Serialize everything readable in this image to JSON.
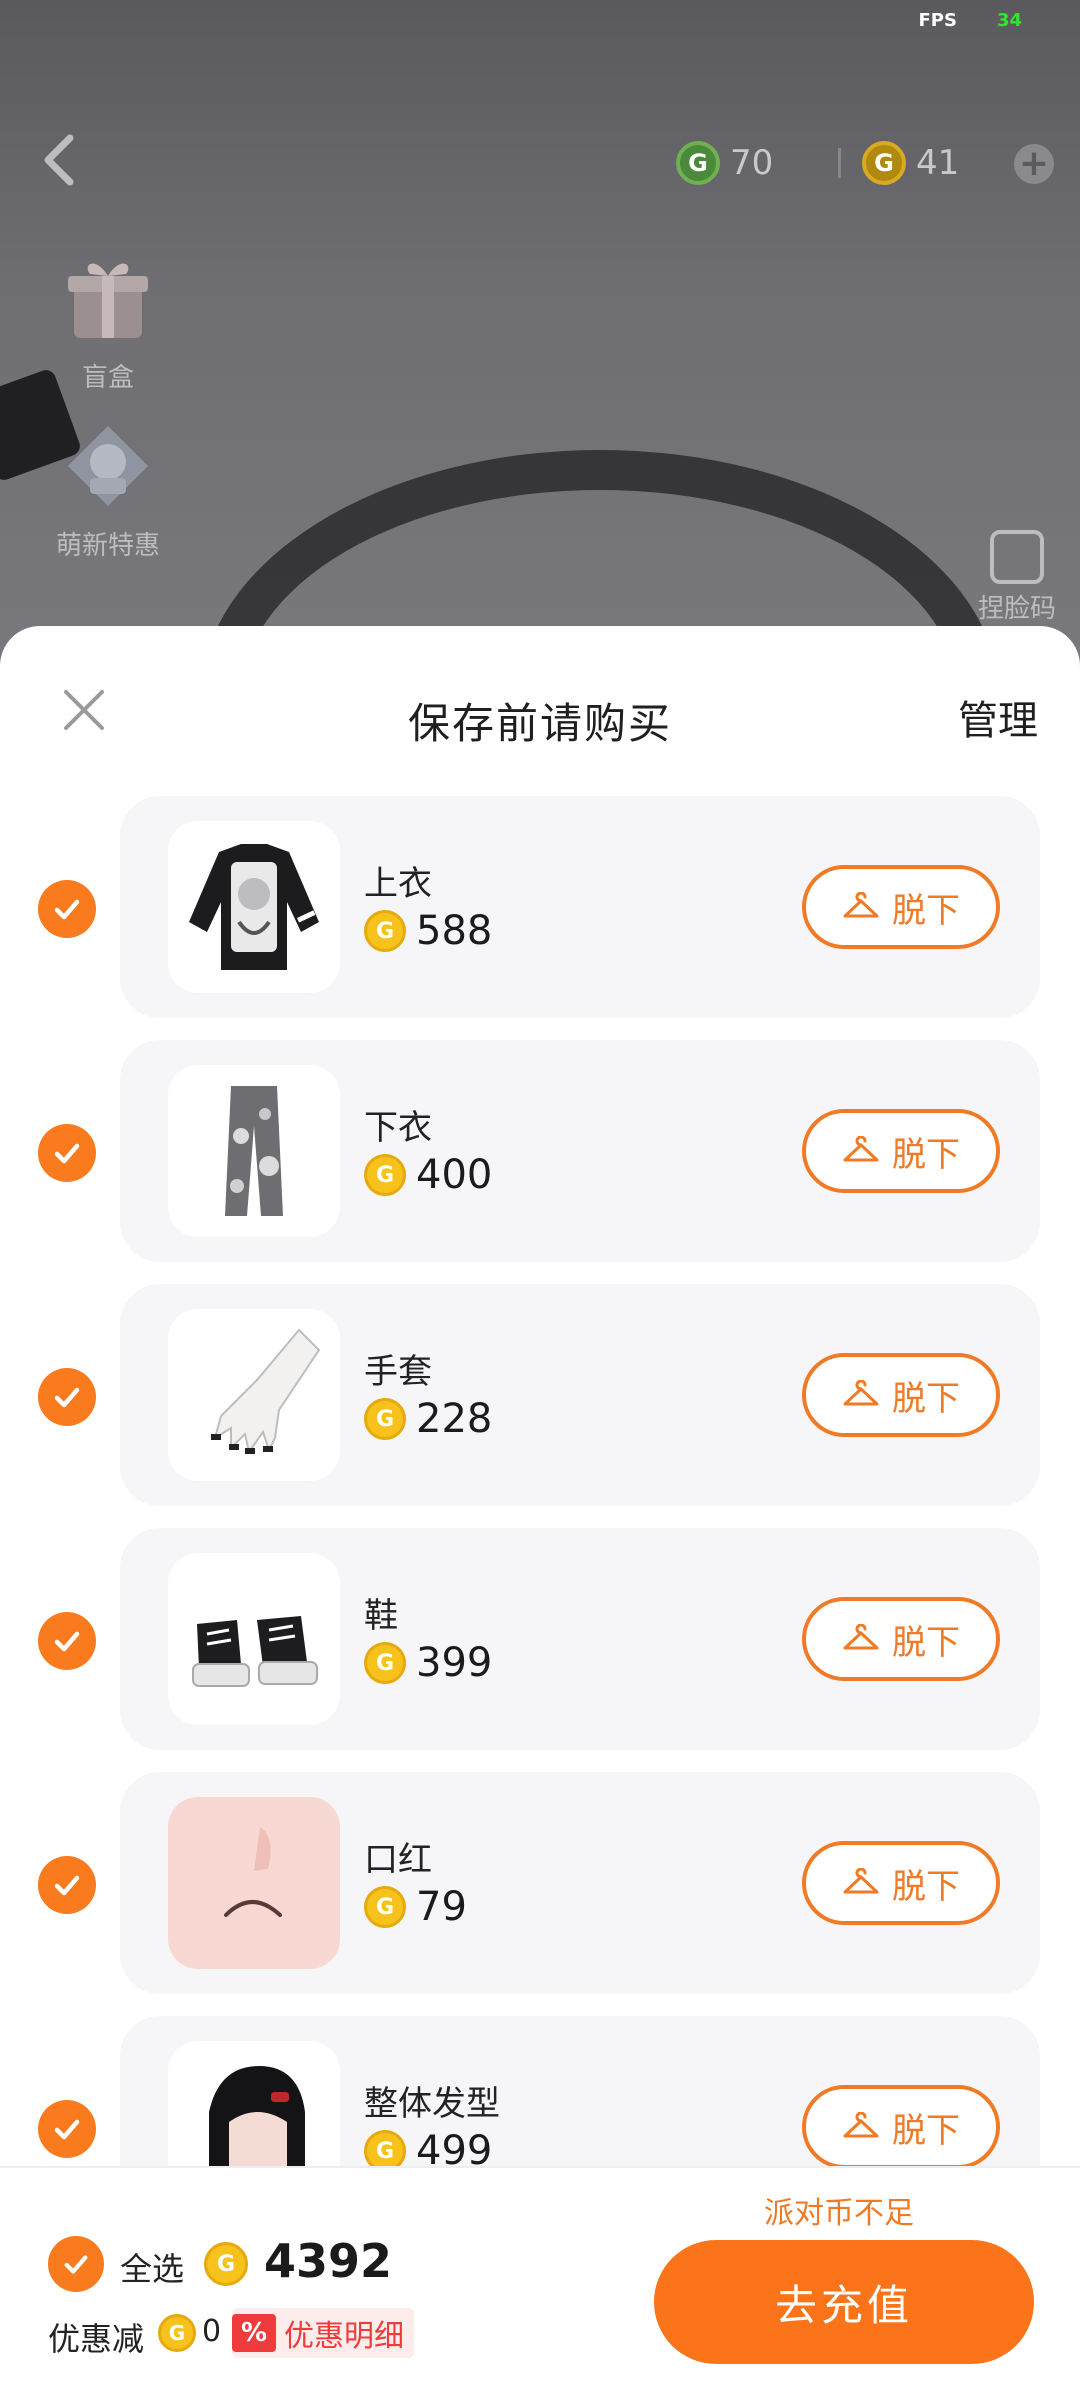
{
  "hud": {
    "fps_label": "FPS",
    "fps_value": "34",
    "green_coins": "70",
    "gold_coins": "41",
    "coin_glyph": "G"
  },
  "side_menu": [
    {
      "label": "盲盒",
      "icon": "gift-box-icon"
    },
    {
      "label": "萌新特惠",
      "icon": "newbie-deal-icon"
    }
  ],
  "pinch_code": {
    "label": "捏脸码",
    "icon": "edit-face-icon"
  },
  "sheet": {
    "title": "保存前请购买",
    "manage_label": "管理",
    "take_off_label": "脱下",
    "items": [
      {
        "name": "上衣",
        "price": "588",
        "thumb": "top-shirt"
      },
      {
        "name": "下衣",
        "price": "400",
        "thumb": "pants"
      },
      {
        "name": "手套",
        "price": "228",
        "thumb": "glove"
      },
      {
        "name": "鞋",
        "price": "399",
        "thumb": "shoes"
      },
      {
        "name": "口红",
        "price": "79",
        "thumb": "lipstick"
      },
      {
        "name": "整体发型",
        "price": "499",
        "thumb": "hairstyle"
      }
    ]
  },
  "footer": {
    "insufficient_text": "派对币不足",
    "select_all_label": "全选",
    "total": "4392",
    "discount_label": "优惠减",
    "discount_value": "0",
    "pct_badge": "%",
    "discount_detail_label": "优惠明细",
    "recharge_label": "去充值"
  },
  "colors": {
    "accent": "#fb7419",
    "coin": "#f6c21b",
    "discount_red": "#ef3b3b"
  }
}
